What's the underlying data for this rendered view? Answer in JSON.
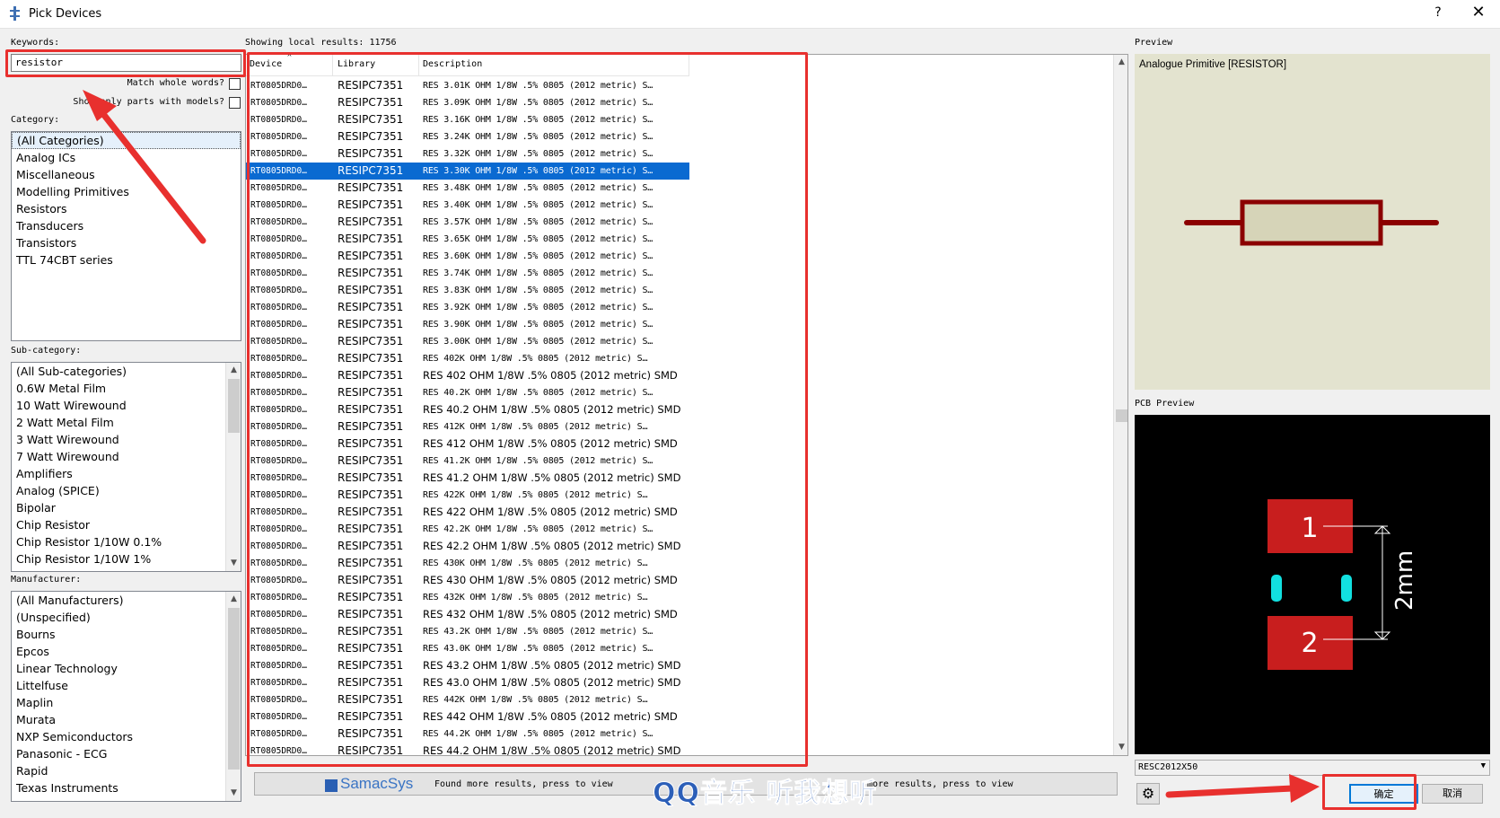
{
  "window": {
    "title": "Pick Devices",
    "help_label": "?",
    "close_label": "✕"
  },
  "left": {
    "keywords_label": "Keywords:",
    "keywords_value": "resistor",
    "match_whole_words_label": "Match whole words?",
    "show_only_models_label": "Show only parts with models?",
    "category_label": "Category:",
    "categories": [
      "(All Categories)",
      "Analog ICs",
      "Miscellaneous",
      "Modelling Primitives",
      "Resistors",
      "Transducers",
      "Transistors",
      "TTL 74CBT series"
    ],
    "subcategory_label": "Sub-category:",
    "subcategories": [
      "(All Sub-categories)",
      "0.6W Metal Film",
      "10 Watt Wirewound",
      "2 Watt Metal Film",
      "3 Watt Wirewound",
      "7 Watt Wirewound",
      "Amplifiers",
      "Analog (SPICE)",
      "Bipolar",
      "Chip Resistor",
      "Chip Resistor 1/10W 0.1%",
      "Chip Resistor 1/10W 1%"
    ],
    "manufacturer_label": "Manufacturer:",
    "manufacturers": [
      "(All Manufacturers)",
      "(Unspecified)",
      "Bourns",
      "Epcos",
      "Linear Technology",
      "Littelfuse",
      "Maplin",
      "Murata",
      "NXP Semiconductors",
      "Panasonic - ECG",
      "Rapid",
      "Texas Instruments"
    ]
  },
  "results": {
    "count_label": "Showing local results: 11756",
    "columns": {
      "device": "Device",
      "library": "Library",
      "description": "Description"
    },
    "selected_index": 5,
    "rows": [
      {
        "device": "RT0805DRD0…",
        "library": "RESIPC7351",
        "description": "RES 3.01K OHM 1/8W .5% 0805 (2012 metric) S…",
        "narrow": true
      },
      {
        "device": "RT0805DRD0…",
        "library": "RESIPC7351",
        "description": "RES 3.09K OHM 1/8W .5% 0805 (2012 metric) S…",
        "narrow": true
      },
      {
        "device": "RT0805DRD0…",
        "library": "RESIPC7351",
        "description": "RES 3.16K OHM 1/8W .5% 0805 (2012 metric) S…",
        "narrow": true
      },
      {
        "device": "RT0805DRD0…",
        "library": "RESIPC7351",
        "description": "RES 3.24K OHM 1/8W .5% 0805 (2012 metric) S…",
        "narrow": true
      },
      {
        "device": "RT0805DRD0…",
        "library": "RESIPC7351",
        "description": "RES 3.32K OHM 1/8W .5% 0805 (2012 metric) S…",
        "narrow": true
      },
      {
        "device": "RT0805DRD0…",
        "library": "RESIPC7351",
        "description": "RES 3.30K OHM 1/8W .5% 0805 (2012 metric) S…",
        "narrow": true
      },
      {
        "device": "RT0805DRD0…",
        "library": "RESIPC7351",
        "description": "RES 3.48K OHM 1/8W .5% 0805 (2012 metric) S…",
        "narrow": true
      },
      {
        "device": "RT0805DRD0…",
        "library": "RESIPC7351",
        "description": "RES 3.40K OHM 1/8W .5% 0805 (2012 metric) S…",
        "narrow": true
      },
      {
        "device": "RT0805DRD0…",
        "library": "RESIPC7351",
        "description": "RES 3.57K OHM 1/8W .5% 0805 (2012 metric) S…",
        "narrow": true
      },
      {
        "device": "RT0805DRD0…",
        "library": "RESIPC7351",
        "description": "RES 3.65K OHM 1/8W .5% 0805 (2012 metric) S…",
        "narrow": true
      },
      {
        "device": "RT0805DRD0…",
        "library": "RESIPC7351",
        "description": "RES 3.60K OHM 1/8W .5% 0805 (2012 metric) S…",
        "narrow": true
      },
      {
        "device": "RT0805DRD0…",
        "library": "RESIPC7351",
        "description": "RES 3.74K OHM 1/8W .5% 0805 (2012 metric) S…",
        "narrow": true
      },
      {
        "device": "RT0805DRD0…",
        "library": "RESIPC7351",
        "description": "RES 3.83K OHM 1/8W .5% 0805 (2012 metric) S…",
        "narrow": true
      },
      {
        "device": "RT0805DRD0…",
        "library": "RESIPC7351",
        "description": "RES 3.92K OHM 1/8W .5% 0805 (2012 metric) S…",
        "narrow": true
      },
      {
        "device": "RT0805DRD0…",
        "library": "RESIPC7351",
        "description": "RES 3.90K OHM 1/8W .5% 0805 (2012 metric) S…",
        "narrow": true
      },
      {
        "device": "RT0805DRD0…",
        "library": "RESIPC7351",
        "description": "RES 3.00K OHM 1/8W .5% 0805 (2012 metric) S…",
        "narrow": true
      },
      {
        "device": "RT0805DRD0…",
        "library": "RESIPC7351",
        "description": "RES 402K OHM 1/8W .5% 0805 (2012 metric) S…",
        "narrow": true
      },
      {
        "device": "RT0805DRD0…",
        "library": "RESIPC7351",
        "description": "RES 402 OHM 1/8W .5% 0805 (2012 metric) SMD",
        "narrow": false
      },
      {
        "device": "RT0805DRD0…",
        "library": "RESIPC7351",
        "description": "RES 40.2K OHM 1/8W .5% 0805 (2012 metric) S…",
        "narrow": true
      },
      {
        "device": "RT0805DRD0…",
        "library": "RESIPC7351",
        "description": "RES 40.2 OHM 1/8W .5% 0805 (2012 metric) SMD",
        "narrow": false
      },
      {
        "device": "RT0805DRD0…",
        "library": "RESIPC7351",
        "description": "RES 412K OHM 1/8W .5% 0805 (2012 metric) S…",
        "narrow": true
      },
      {
        "device": "RT0805DRD0…",
        "library": "RESIPC7351",
        "description": "RES 412 OHM 1/8W .5% 0805 (2012 metric) SMD",
        "narrow": false
      },
      {
        "device": "RT0805DRD0…",
        "library": "RESIPC7351",
        "description": "RES 41.2K OHM 1/8W .5% 0805 (2012 metric) S…",
        "narrow": true
      },
      {
        "device": "RT0805DRD0…",
        "library": "RESIPC7351",
        "description": "RES 41.2 OHM 1/8W .5% 0805 (2012 metric) SMD",
        "narrow": false
      },
      {
        "device": "RT0805DRD0…",
        "library": "RESIPC7351",
        "description": "RES 422K OHM 1/8W .5% 0805 (2012 metric) S…",
        "narrow": true
      },
      {
        "device": "RT0805DRD0…",
        "library": "RESIPC7351",
        "description": "RES 422 OHM 1/8W .5% 0805 (2012 metric) SMD",
        "narrow": false
      },
      {
        "device": "RT0805DRD0…",
        "library": "RESIPC7351",
        "description": "RES 42.2K OHM 1/8W .5% 0805 (2012 metric) S…",
        "narrow": true
      },
      {
        "device": "RT0805DRD0…",
        "library": "RESIPC7351",
        "description": "RES 42.2 OHM 1/8W .5% 0805 (2012 metric) SMD",
        "narrow": false
      },
      {
        "device": "RT0805DRD0…",
        "library": "RESIPC7351",
        "description": "RES 430K OHM 1/8W .5% 0805 (2012 metric) S…",
        "narrow": true
      },
      {
        "device": "RT0805DRD0…",
        "library": "RESIPC7351",
        "description": "RES 430 OHM 1/8W .5% 0805 (2012 metric) SMD",
        "narrow": false
      },
      {
        "device": "RT0805DRD0…",
        "library": "RESIPC7351",
        "description": "RES 432K OHM 1/8W .5% 0805 (2012 metric) S…",
        "narrow": true
      },
      {
        "device": "RT0805DRD0…",
        "library": "RESIPC7351",
        "description": "RES 432 OHM 1/8W .5% 0805 (2012 metric) SMD",
        "narrow": false
      },
      {
        "device": "RT0805DRD0…",
        "library": "RESIPC7351",
        "description": "RES 43.2K OHM 1/8W .5% 0805 (2012 metric) S…",
        "narrow": true
      },
      {
        "device": "RT0805DRD0…",
        "library": "RESIPC7351",
        "description": "RES 43.0K OHM 1/8W .5% 0805 (2012 metric) S…",
        "narrow": true
      },
      {
        "device": "RT0805DRD0…",
        "library": "RESIPC7351",
        "description": "RES 43.2 OHM 1/8W .5% 0805 (2012 metric) SMD",
        "narrow": false
      },
      {
        "device": "RT0805DRD0…",
        "library": "RESIPC7351",
        "description": "RES 43.0 OHM 1/8W .5% 0805 (2012 metric) SMD",
        "narrow": false
      },
      {
        "device": "RT0805DRD0…",
        "library": "RESIPC7351",
        "description": "RES 442K OHM 1/8W .5% 0805 (2012 metric) S…",
        "narrow": true
      },
      {
        "device": "RT0805DRD0…",
        "library": "RESIPC7351",
        "description": "RES 442 OHM 1/8W .5% 0805 (2012 metric) SMD",
        "narrow": false
      },
      {
        "device": "RT0805DRD0…",
        "library": "RESIPC7351",
        "description": "RES 44.2K OHM 1/8W .5% 0805 (2012 metric) S…",
        "narrow": true
      },
      {
        "device": "RT0805DRD0…",
        "library": "RESIPC7351",
        "description": "RES 44.2 OHM 1/8W .5% 0805 (2012 metric) SMD",
        "narrow": false
      }
    ]
  },
  "samacsys": {
    "logo": "SamacSys",
    "found_more": "Found more results, press to view",
    "found_more_2": "more results, press to view"
  },
  "watermark": "QQ音乐 听我想听",
  "preview": {
    "label": "Preview",
    "caption": "Analogue Primitive [RESISTOR]",
    "body_color": "#d6d4b8",
    "outline_color": "#8b0000"
  },
  "pcb": {
    "label": "PCB Preview",
    "pad1": "1",
    "pad2": "2",
    "dimension": "2mm",
    "pad_color": "#c81e1e",
    "pin_color": "#12e0e0",
    "package": "RESC2012X50"
  },
  "buttons": {
    "ok": "确定",
    "cancel": "取消"
  },
  "annotations": {
    "color": "#e8302e"
  }
}
